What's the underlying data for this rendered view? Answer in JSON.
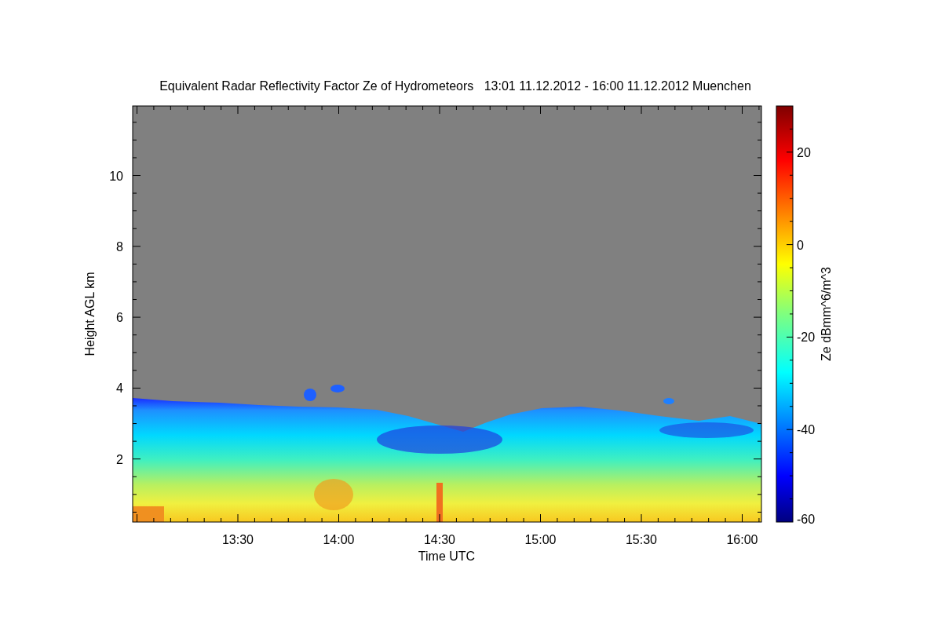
{
  "plot": {
    "title": "Equivalent Radar Reflectivity Factor Ze of Hydrometeors   13:01 11.12.2012 - 16:00 11.12.2012 Muenchen",
    "xlabel": "Time UTC",
    "ylabel": "Height AGL km",
    "x_tick_labels": [
      "13:30",
      "14:00",
      "14:30",
      "15:00",
      "15:30",
      "16:00"
    ],
    "y_tick_labels": [
      "10",
      "8",
      "6",
      "4",
      "2"
    ]
  },
  "colorbar": {
    "label": "Ze dBmm^6/m^3",
    "tick_labels": [
      "20",
      "0",
      "-20",
      "-40",
      "-60"
    ]
  }
}
